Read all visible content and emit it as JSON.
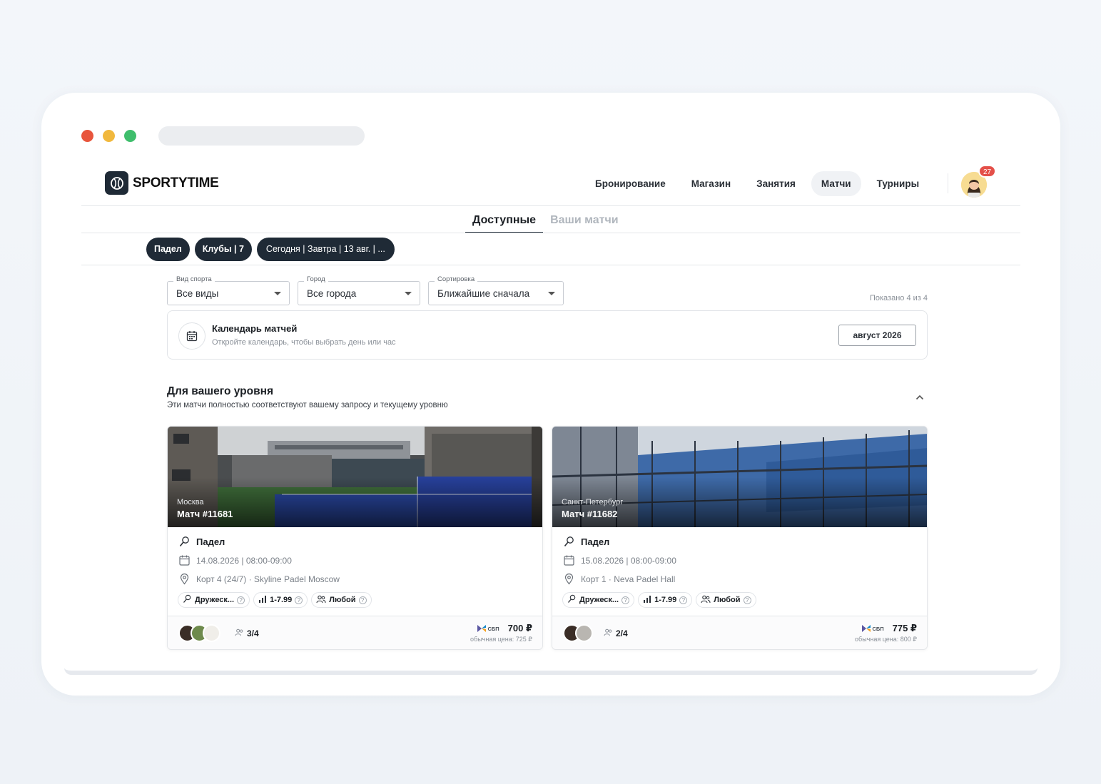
{
  "brand": {
    "name": "SPORTYTIME"
  },
  "nav": {
    "items": [
      {
        "label": "Бронирование",
        "active": false
      },
      {
        "label": "Магазин",
        "active": false
      },
      {
        "label": "Занятия",
        "active": false
      },
      {
        "label": "Матчи",
        "active": true
      },
      {
        "label": "Турниры",
        "active": false
      }
    ],
    "notifications": "27"
  },
  "subtabs": [
    {
      "label": "Доступные",
      "active": true
    },
    {
      "label": "Ваши матчи",
      "active": false
    }
  ],
  "chips": [
    "Падел",
    "Клубы | 7",
    "Сегодня | Завтра | 13 авг. | ..."
  ],
  "filters": {
    "sport": {
      "label": "Вид спорта",
      "value": "Все виды"
    },
    "city": {
      "label": "Город",
      "value": "Все города"
    },
    "sort": {
      "label": "Сортировка",
      "value": "Ближайшие сначала"
    }
  },
  "shown_count": "Показано 4 из 4",
  "calendar": {
    "title": "Календарь матчей",
    "subtitle": "Откройте календарь, чтобы выбрать день или час",
    "button": "август 2026"
  },
  "section": {
    "title": "Для вашего уровня",
    "subtitle": "Эти матчи полностью соответствуют вашему запросу и текущему уровню"
  },
  "matches": [
    {
      "city": "Москва",
      "title": "Матч #11681",
      "sport": "Падел",
      "datetime": "14.08.2026 | 08:00-09:00",
      "place": "Корт 4 (24/7) · Skyline Padel Moscow",
      "tags": [
        "Дружеск...",
        "1-7.99",
        "Любой"
      ],
      "players": "3/4",
      "payment": "СБП",
      "price": "700 ₽",
      "regular_price": "обычная цена: 725 ₽"
    },
    {
      "city": "Санкт-Петербург",
      "title": "Матч #11682",
      "sport": "Падел",
      "datetime": "15.08.2026 | 08:00-09:00",
      "place": "Корт 1 · Neva Padel Hall",
      "tags": [
        "Дружеск...",
        "1-7.99",
        "Любой"
      ],
      "players": "2/4",
      "payment": "СБП",
      "price": "775 ₽",
      "regular_price": "обычная цена: 800 ₽"
    }
  ],
  "icons": [
    "tennis-ball-icon",
    "chevron-down-icon",
    "calendar-icon",
    "chevron-up-icon",
    "sport-icon",
    "location-icon",
    "level-icon",
    "people-icon",
    "help-icon",
    "sbp-icon"
  ],
  "colors": {
    "primary": "#1f2a36",
    "badge": "#e45049",
    "accent_red": "#e8553c",
    "accent_yellow": "#f1b83d",
    "accent_green": "#3fbe6c"
  }
}
